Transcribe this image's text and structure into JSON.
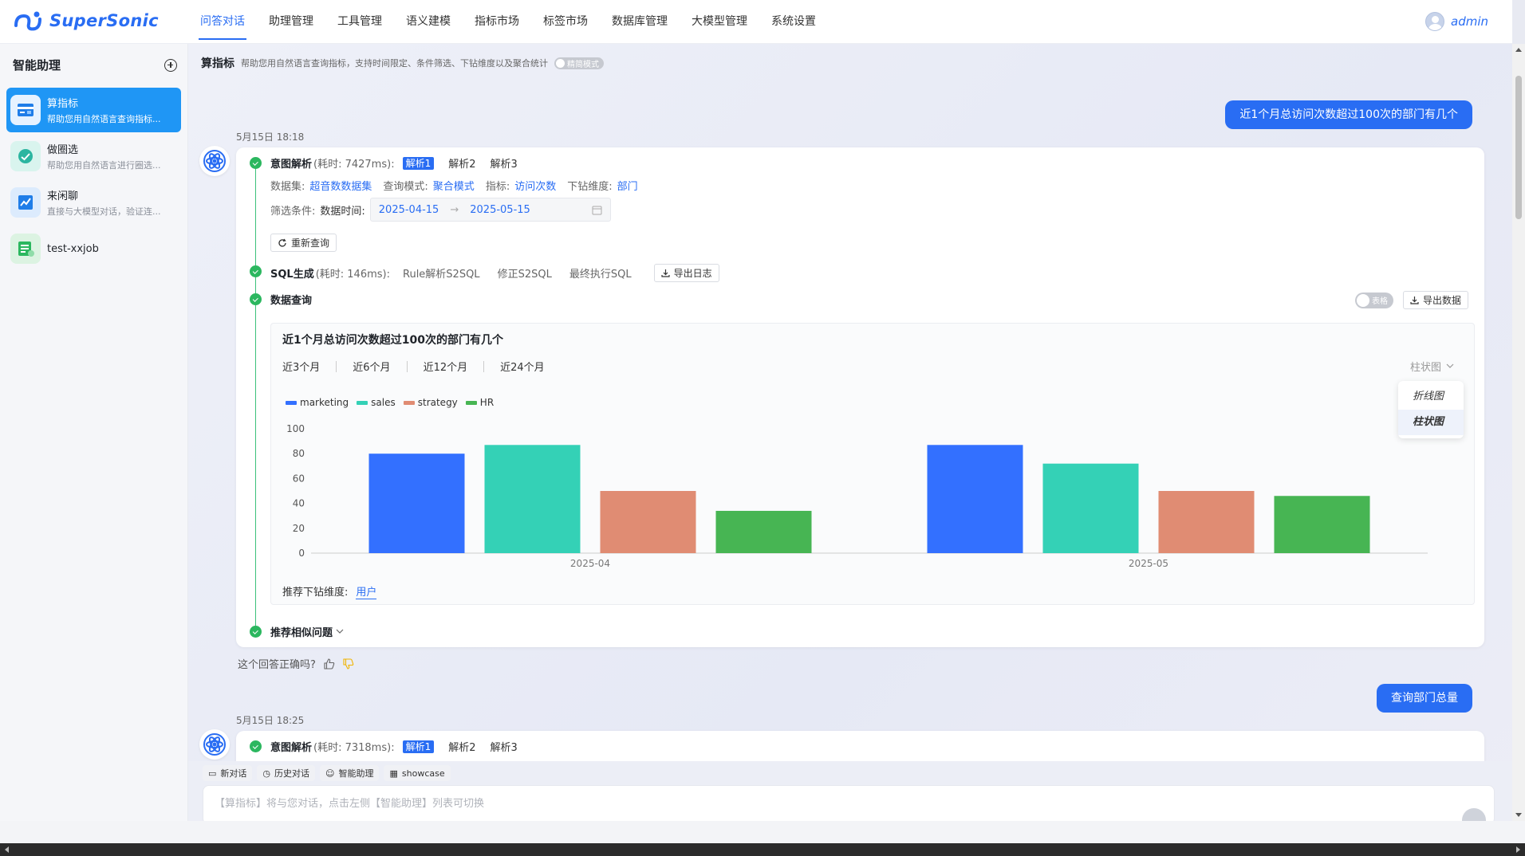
{
  "app": {
    "name": "SuperSonic",
    "user": "admin"
  },
  "nav": [
    "问答对话",
    "助理管理",
    "工具管理",
    "语义建模",
    "指标市场",
    "标签市场",
    "数据库管理",
    "大模型管理",
    "系统设置"
  ],
  "sidebar": {
    "title": "智能助理",
    "agents": [
      {
        "name": "算指标",
        "desc": "帮助您用自然语言查询指标...",
        "icon": "metric-card-icon",
        "color": "#1f96f5"
      },
      {
        "name": "做圈选",
        "desc": "帮助您用自然语言进行圈选...",
        "icon": "circle-select-icon",
        "color": "#2bb5a0"
      },
      {
        "name": "来闲聊",
        "desc": "直接与大模型对话，验证连...",
        "icon": "chat-chart-icon",
        "color": "#1f7de8"
      },
      {
        "name": "test-xxjob",
        "desc": "",
        "icon": "table-icon",
        "color": "#2bb75f"
      }
    ]
  },
  "header": {
    "title": "算指标",
    "desc": "帮助您用自然语言查询指标，支持时间限定、条件筛选、下钻维度以及聚合统计",
    "mode_toggle": "精简模式"
  },
  "conversation": {
    "q1": "近1个月总访问次数超过100次的部门有几个",
    "t1": "5月15日 18:18",
    "parse_label": "意图解析",
    "parse_time_1": "(耗时: 7427ms):",
    "parse_tabs": [
      "解析1",
      "解析2",
      "解析3"
    ],
    "dataset_label": "数据集:",
    "dataset": "超音数数据集",
    "mode_label": "查询模式:",
    "mode": "聚合模式",
    "metric_label": "指标:",
    "metric": "访问次数",
    "dim_label": "下钻维度:",
    "dim": "部门",
    "filter_label": "筛选条件:",
    "date_label": "数据时间:",
    "date_start": "2025-04-15",
    "date_end": "2025-05-15",
    "requery": "重新查询",
    "sql_label": "SQL生成",
    "sql_time": "(耗时: 146ms):",
    "sql_tabs": [
      "Rule解析S2SQL",
      "修正S2SQL",
      "最终执行SQL"
    ],
    "export_log": "导出日志",
    "data_label": "数据查询",
    "table_toggle": "表格",
    "export_data": "导出数据",
    "similar": "推荐相似问题",
    "feedback": "这个回答正确吗?",
    "q2": "查询部门总量",
    "t2": "5月15日 18:25",
    "parse_time_2": "(耗时: 7318ms):"
  },
  "chart_data": {
    "type": "bar",
    "title": "近1个月总访问次数超过100次的部门有几个",
    "periods": [
      "近3个月",
      "近6个月",
      "近12个月",
      "近24个月"
    ],
    "chart_type_label": "柱状图",
    "chart_type_options": [
      "折线图",
      "柱状图"
    ],
    "categories": [
      "2025-04",
      "2025-05"
    ],
    "series": [
      {
        "name": "marketing",
        "color": "#3370ff",
        "values": [
          80,
          87
        ]
      },
      {
        "name": "sales",
        "color": "#34d1b6",
        "values": [
          87,
          72
        ]
      },
      {
        "name": "strategy",
        "color": "#e08c73",
        "values": [
          50,
          50
        ]
      },
      {
        "name": "HR",
        "color": "#47b553",
        "values": [
          34,
          46
        ]
      }
    ],
    "ylim": [
      0,
      100
    ],
    "yticks": [
      0,
      20,
      40,
      60,
      80,
      100
    ],
    "drill_label": "推荐下钻维度:",
    "drill_value": "用户"
  },
  "input": {
    "tools": [
      "新对话",
      "历史对话",
      "智能助理",
      "showcase"
    ],
    "placeholder": "【算指标】将与您对话，点击左侧【智能助理】列表可切换"
  }
}
